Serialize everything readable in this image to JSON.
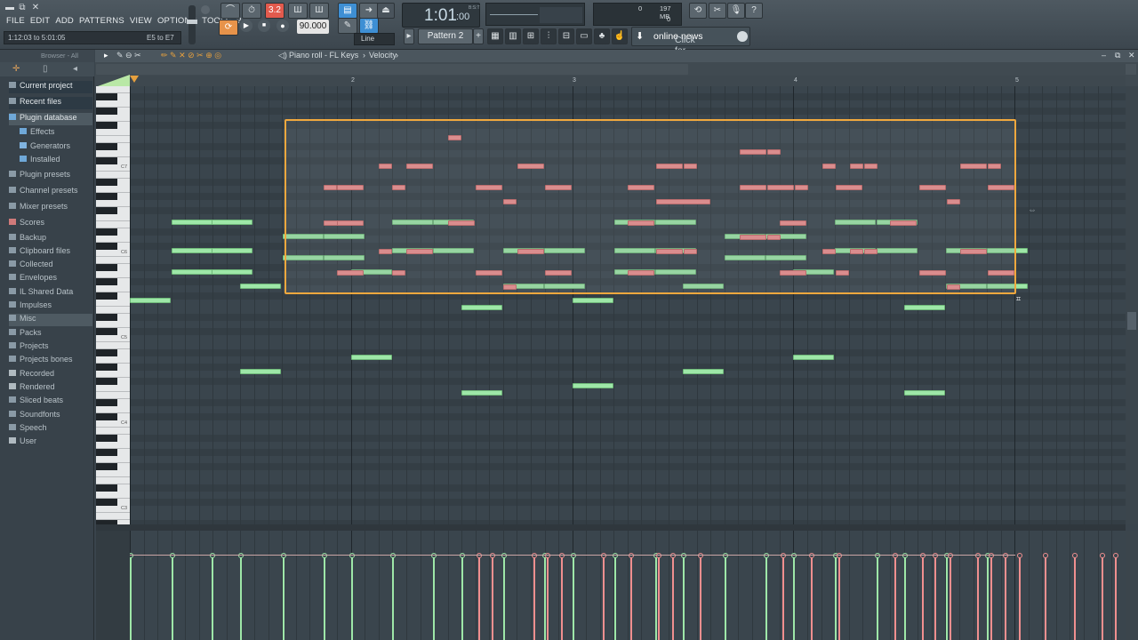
{
  "window": {
    "min_btn": "▬",
    "restore_btn": "⧉",
    "close_btn": "✕"
  },
  "menu": [
    "FILE",
    "EDIT",
    "ADD",
    "PATTERNS",
    "VIEW",
    "OPTIONS",
    "TOOLS",
    "?"
  ],
  "hint": {
    "left": "1:12:03 to 5:01:05",
    "right": "E5 to E7"
  },
  "transport": {
    "pattern_song": "3.2",
    "play": "▶",
    "stop": "■",
    "record": "●",
    "tempo": "90.000"
  },
  "clock": {
    "time": "1:01",
    "ticks": ":00",
    "label": "B:S:T"
  },
  "cpu": {
    "ram": "197 MB",
    "cpu": "0",
    "voices": "0"
  },
  "snap": {
    "label": "Line"
  },
  "pattern": {
    "label": "Pattern 2"
  },
  "news": {
    "prefix": "Click for ",
    "bold": "online news"
  },
  "browser": {
    "header": "Browser - All",
    "items": [
      {
        "label": "Current project",
        "icon": "folder-icon",
        "hl": true
      },
      {
        "label": "Recent files",
        "icon": "folder-icon",
        "hl": true
      },
      {
        "label": "Plugin database",
        "icon": "plug-icon",
        "hl": true,
        "sel": true
      },
      {
        "label": "Effects",
        "icon": "plug-icon",
        "sub": true
      },
      {
        "label": "Generators",
        "icon": "bars-icon",
        "sub": true
      },
      {
        "label": "Installed",
        "icon": "plug-icon",
        "sub": true
      },
      {
        "label": "Plugin presets",
        "icon": "folder-icon"
      },
      {
        "label": "Channel presets",
        "icon": "folder-icon"
      },
      {
        "label": "Mixer presets",
        "icon": "folder-icon"
      },
      {
        "label": "Scores",
        "icon": "note-icon"
      },
      {
        "label": "Backup",
        "icon": "folder-icon"
      },
      {
        "label": "Clipboard files",
        "icon": "folder-icon"
      },
      {
        "label": "Collected",
        "icon": "folder-icon"
      },
      {
        "label": "Envelopes",
        "icon": "folder-icon"
      },
      {
        "label": "IL Shared Data",
        "icon": "folder-icon"
      },
      {
        "label": "Impulses",
        "icon": "folder-icon"
      },
      {
        "label": "Misc",
        "icon": "folder-icon",
        "sel": true
      },
      {
        "label": "Packs",
        "icon": "folder-icon"
      },
      {
        "label": "Projects",
        "icon": "folder-icon"
      },
      {
        "label": "Projects bones",
        "icon": "folder-icon"
      },
      {
        "label": "Recorded",
        "icon": "mic-icon"
      },
      {
        "label": "Rendered",
        "icon": "disk-icon"
      },
      {
        "label": "Sliced beats",
        "icon": "folder-icon"
      },
      {
        "label": "Soundfonts",
        "icon": "folder-icon"
      },
      {
        "label": "Speech",
        "icon": "folder-icon"
      },
      {
        "label": "User",
        "icon": "user-icon"
      }
    ]
  },
  "pianoroll": {
    "title": "Piano roll - FL Keys",
    "sep": "›",
    "target": "Velocity",
    "bars": [
      "2",
      "3",
      "4",
      "5"
    ],
    "keys": [
      "C7",
      "C6",
      "C5",
      "C4",
      "C3"
    ]
  },
  "colors": {
    "selection": "#f0a83e",
    "note_green": "#9ee7a8",
    "note_red": "#f08f8f"
  }
}
